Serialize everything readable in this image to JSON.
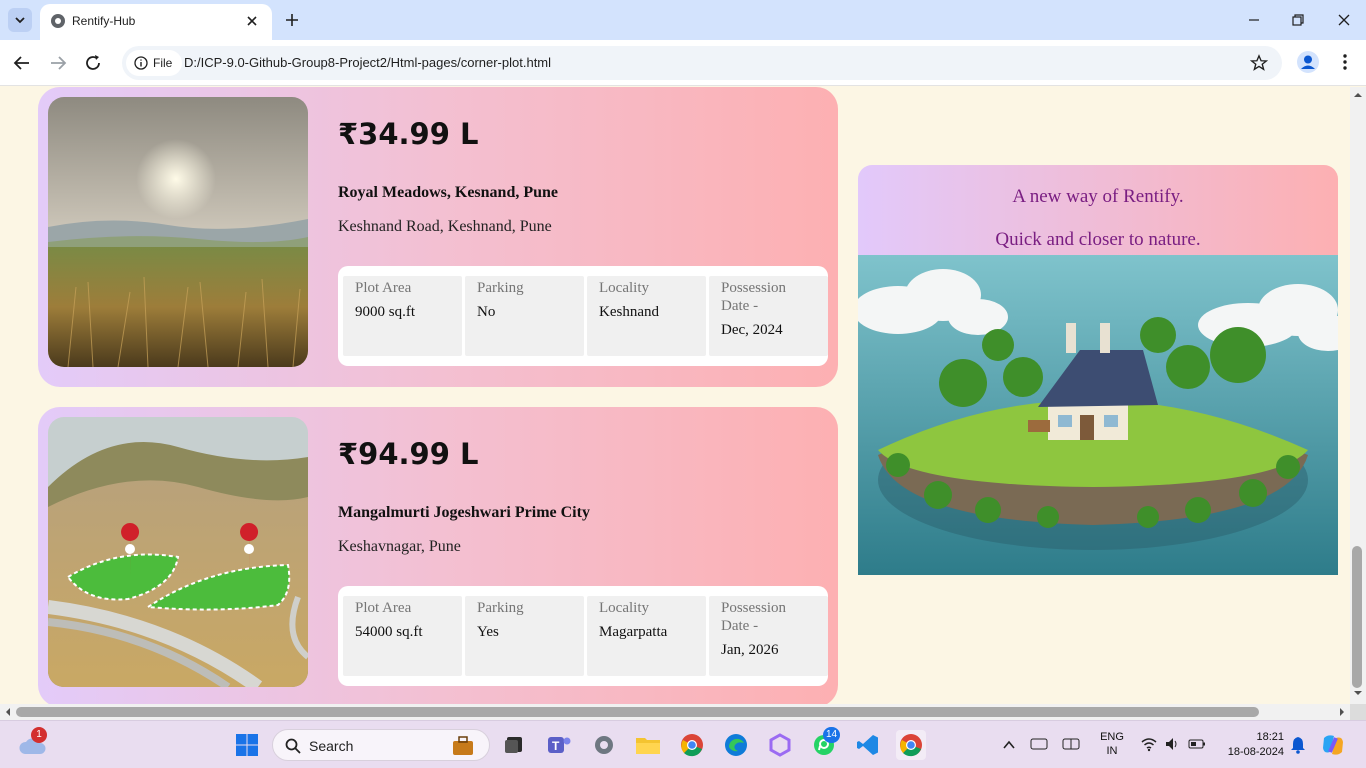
{
  "browser": {
    "tab_title": "Rentify-Hub",
    "omnibox_chip": "File",
    "url": "D:/ICP-9.0-Github-Group8-Project2/Html-pages/corner-plot.html"
  },
  "listings": [
    {
      "price": "₹34.99 L",
      "name": "Royal Meadows, Kesnand, Pune",
      "address": "Keshnand Road, Keshnand, Pune",
      "specs": [
        {
          "label": "Plot Area",
          "value": "9000 sq.ft"
        },
        {
          "label": "Parking",
          "value": "No"
        },
        {
          "label": "Locality",
          "value": "Keshnand"
        },
        {
          "label": "Possession Date -",
          "value": "Dec, 2024"
        }
      ]
    },
    {
      "price": "₹94.99 L",
      "name": "Mangalmurti Jogeshwari Prime City",
      "address": "Keshavnagar, Pune",
      "specs": [
        {
          "label": "Plot Area",
          "value": "54000 sq.ft"
        },
        {
          "label": "Parking",
          "value": "Yes"
        },
        {
          "label": "Locality",
          "value": "Magarpatta"
        },
        {
          "label": "Possession Date -",
          "value": "Jan, 2026"
        }
      ]
    }
  ],
  "promo": {
    "line1": "A new way of Rentify.",
    "line2": "Quick and closer to nature."
  },
  "taskbar": {
    "search_label": "Search",
    "weather_badge": "1",
    "whatsapp_badge": "14",
    "language_line1": "ENG",
    "language_line2": "IN",
    "time": "18:21",
    "date": "18-08-2024"
  },
  "colors": {
    "page_bg": "#fcf6e4",
    "card_gradient_start": "#e3cbf9",
    "card_gradient_end": "#fdb0b2",
    "promo_text": "#7a1e82"
  }
}
